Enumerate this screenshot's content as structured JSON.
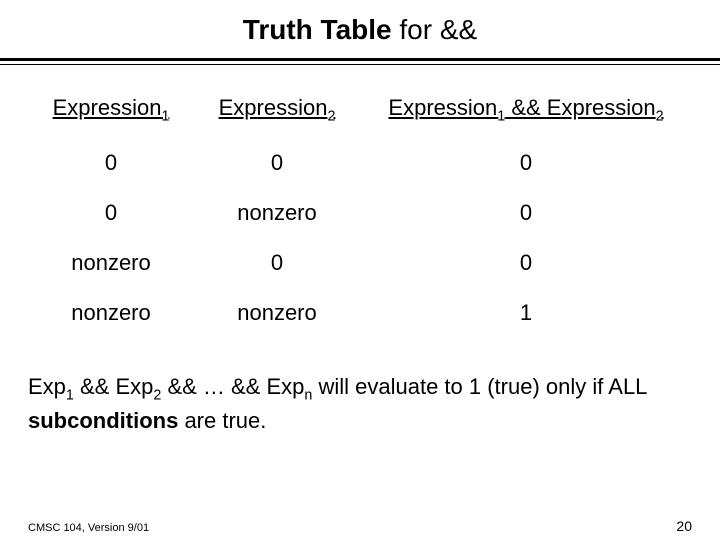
{
  "title": {
    "bold": "Truth Table",
    "rest": " for &&"
  },
  "chart_data": {
    "type": "table",
    "columns": [
      "Expression1",
      "Expression2",
      "Expression1 && Expression2"
    ],
    "rows": [
      [
        "0",
        "0",
        "0"
      ],
      [
        "0",
        "nonzero",
        "0"
      ],
      [
        "nonzero",
        "0",
        "0"
      ],
      [
        "nonzero",
        "nonzero",
        "1"
      ]
    ]
  },
  "headers": {
    "expr": "Expression",
    "sub1": "1",
    "sub2": "2",
    "and": " && "
  },
  "summary": {
    "exp": "Exp",
    "s1": "1",
    "and": " && ",
    "s2": "2",
    "dots": " && … && ",
    "sn": "n",
    "tail": "  will evaluate to 1 (true) only if ALL ",
    "bold": "subconditions",
    "end": " are true."
  },
  "footer": {
    "left": "CMSC 104, Version 9/01",
    "right": "20"
  }
}
